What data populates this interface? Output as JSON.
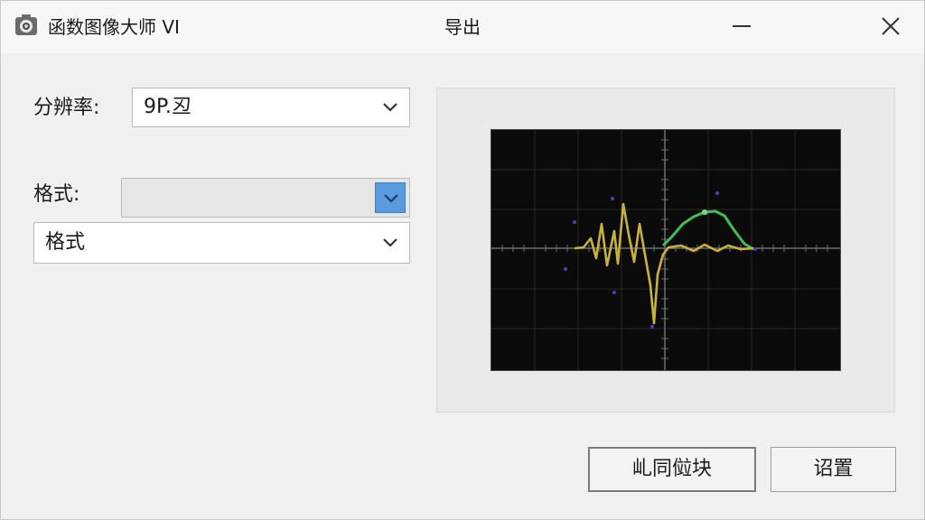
{
  "window": {
    "app_title": "函数图像大师 VI",
    "dialog_title": "导出",
    "app_icon": "camera-icon"
  },
  "form": {
    "resolution_label": "分辨率:",
    "resolution_value": "9P.丒",
    "format_label": "格式:",
    "format_top_value": "",
    "format_value": "格式"
  },
  "preview": {
    "colors": {
      "background": "#0b0b0b",
      "grid": "#2e2e2e",
      "axis": "#7a7a7a",
      "yellow_trace": "#c9b23a",
      "green_trace": "#3fbf55",
      "markers": "#5a4bd0"
    }
  },
  "buttons": {
    "primary_label": "乢同傡块",
    "secondary_label": "诏置"
  }
}
